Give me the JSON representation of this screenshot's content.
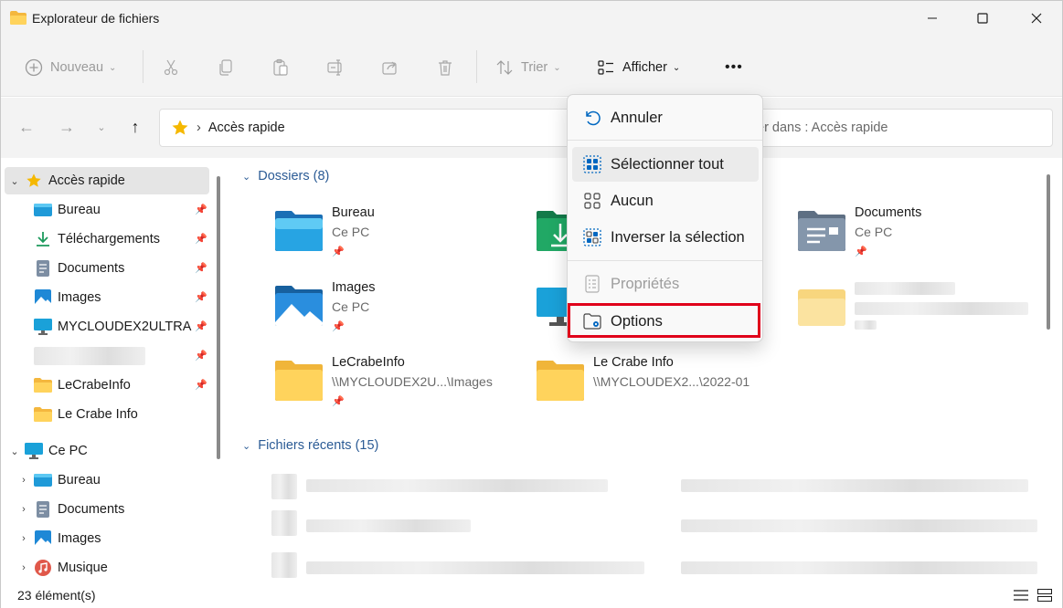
{
  "window": {
    "title": "Explorateur de fichiers"
  },
  "toolbar": {
    "new_label": "Nouveau",
    "sort_label": "Trier",
    "view_label": "Afficher",
    "more_label": "•••"
  },
  "address": {
    "path_label": "Accès rapide",
    "search_placeholder": "er dans : Accès rapide"
  },
  "sidebar": {
    "quick_access": "Accès rapide",
    "items": [
      {
        "label": "Bureau"
      },
      {
        "label": "Téléchargements"
      },
      {
        "label": "Documents"
      },
      {
        "label": "Images"
      },
      {
        "label": "MYCLOUDEX2ULTRA"
      },
      {
        "label": ""
      },
      {
        "label": "LeCrabeInfo"
      },
      {
        "label": "Le Crabe Info"
      }
    ],
    "this_pc": "Ce PC",
    "pc_items": [
      {
        "label": "Bureau"
      },
      {
        "label": "Documents"
      },
      {
        "label": "Images"
      },
      {
        "label": "Musique"
      }
    ]
  },
  "main": {
    "folders_header": "Dossiers (8)",
    "recent_header": "Fichiers récents (15)",
    "tiles": [
      {
        "name": "Bureau",
        "sub": "Ce PC"
      },
      {
        "name": "Documents",
        "sub": "Ce PC"
      },
      {
        "name": "Images",
        "sub": "Ce PC"
      },
      {
        "name": "LeCrabeInfo",
        "sub": "\\\\MYCLOUDEX2U...\\Images"
      },
      {
        "name": "Le Crabe Info",
        "sub": "\\\\MYCLOUDEX2...\\2022-01"
      }
    ]
  },
  "menu": {
    "items": [
      {
        "label": "Annuler"
      },
      {
        "label": "Sélectionner tout"
      },
      {
        "label": "Aucun"
      },
      {
        "label": "Inverser la sélection"
      },
      {
        "label": "Propriétés"
      },
      {
        "label": "Options"
      }
    ]
  },
  "status": {
    "count": "23 élément(s)"
  },
  "colors": {
    "accent": "#0067c0",
    "highlight": "#e0001a",
    "folder": "#f7c948"
  }
}
